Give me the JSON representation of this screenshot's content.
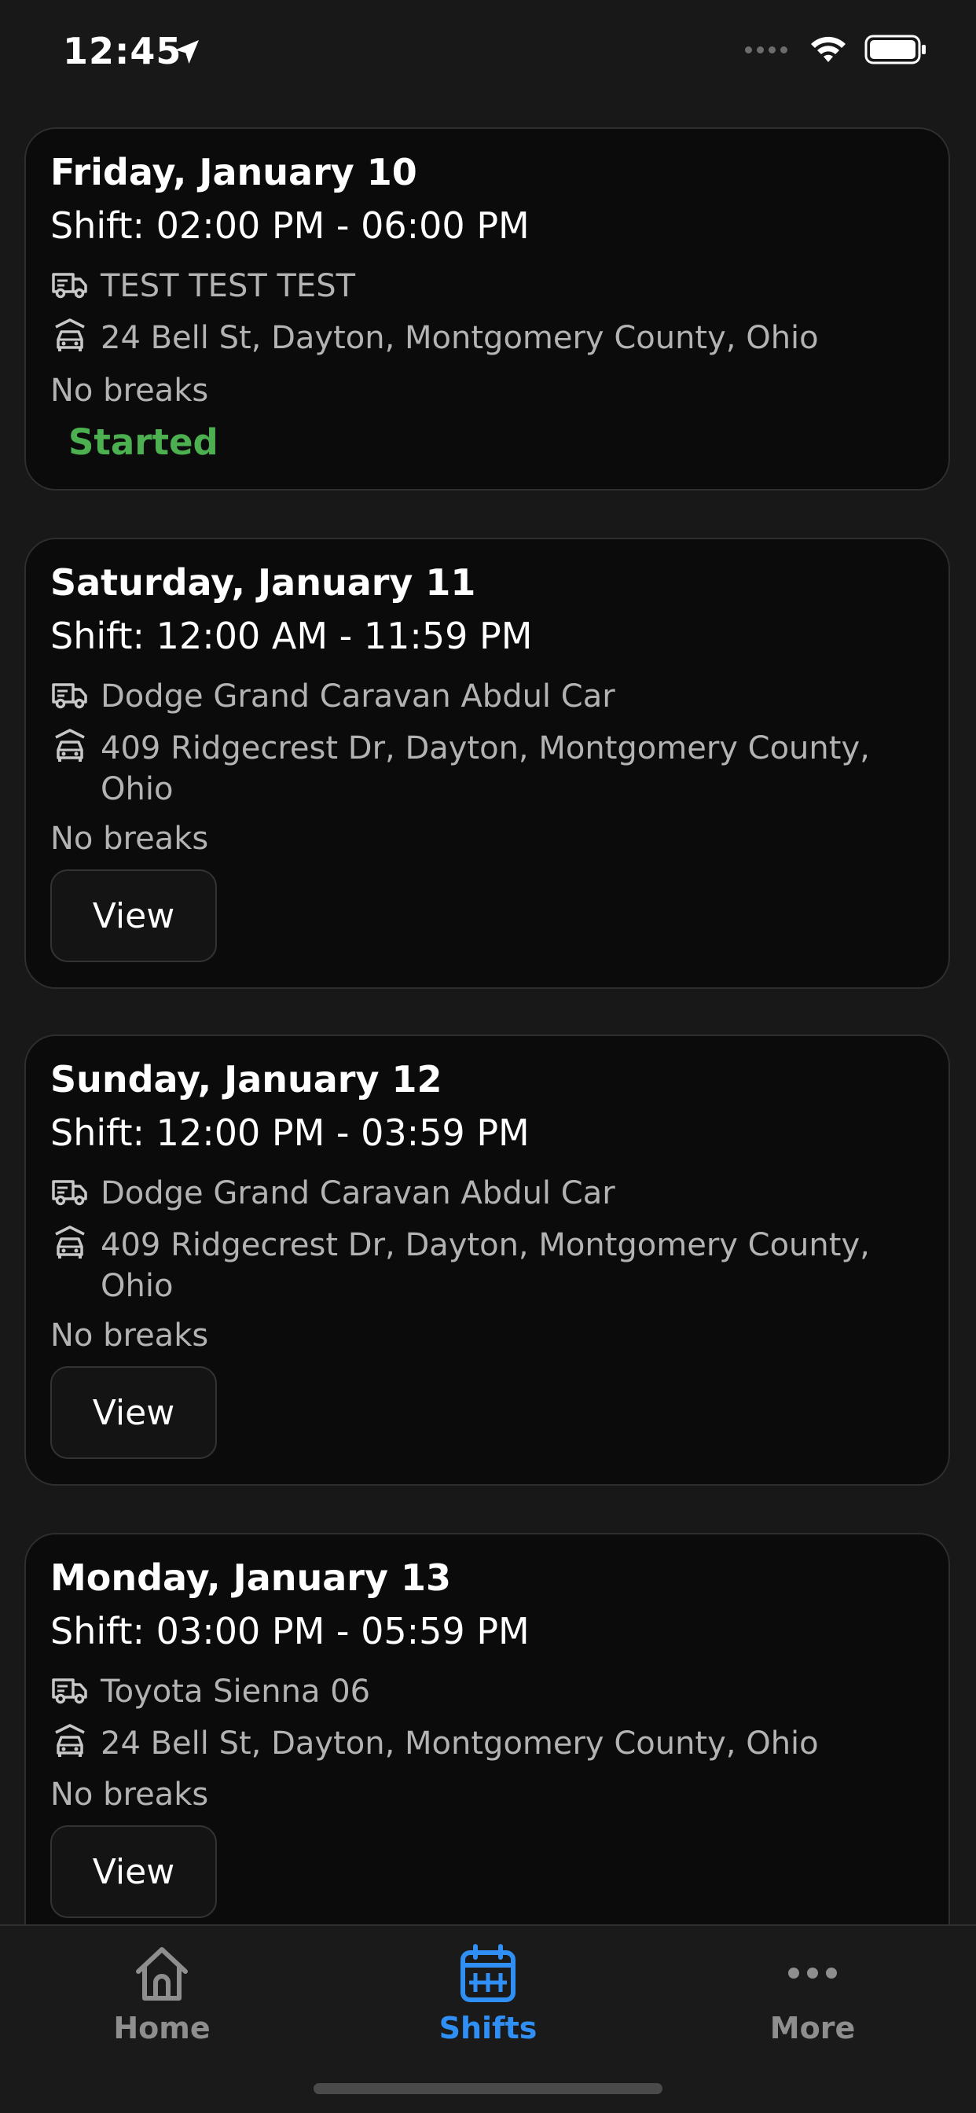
{
  "status_bar": {
    "time": "12:45"
  },
  "shifts": [
    {
      "date": "Friday, January 10",
      "shift": "Shift: 02:00 PM - 06:00 PM",
      "vehicle": "TEST TEST TEST",
      "address": "24 Bell St, Dayton, Montgomery County, Ohio",
      "breaks": "No breaks",
      "status": "Started"
    },
    {
      "date": "Saturday, January 11",
      "shift": "Shift: 12:00 AM - 11:59 PM",
      "vehicle": "Dodge Grand Caravan Abdul Car",
      "address": "409 Ridgecrest Dr, Dayton, Montgomery County, Ohio",
      "breaks": "No breaks",
      "button": "View"
    },
    {
      "date": "Sunday, January 12",
      "shift": "Shift: 12:00 PM - 03:59 PM",
      "vehicle": "Dodge Grand Caravan Abdul Car",
      "address": "409 Ridgecrest Dr, Dayton, Montgomery County, Ohio",
      "breaks": "No breaks",
      "button": "View"
    },
    {
      "date": "Monday, January 13",
      "shift": "Shift: 03:00 PM - 05:59 PM",
      "vehicle": "Toyota Sienna 06",
      "address": "24 Bell St, Dayton, Montgomery County, Ohio",
      "breaks": "No breaks",
      "button": "View"
    }
  ],
  "tab_bar": {
    "items": [
      {
        "label": "Home",
        "icon": "home-icon",
        "active": false
      },
      {
        "label": "Shifts",
        "icon": "calendar-icon",
        "active": true
      },
      {
        "label": "More",
        "icon": "more-icon",
        "active": false
      }
    ]
  },
  "colors": {
    "background": "#181818",
    "card": "#0b0b0b",
    "started": "#4caf50",
    "active_tab": "#2f8ff5",
    "inactive_tab": "#8e8e8e",
    "secondary_text": "#b3b3b3"
  }
}
